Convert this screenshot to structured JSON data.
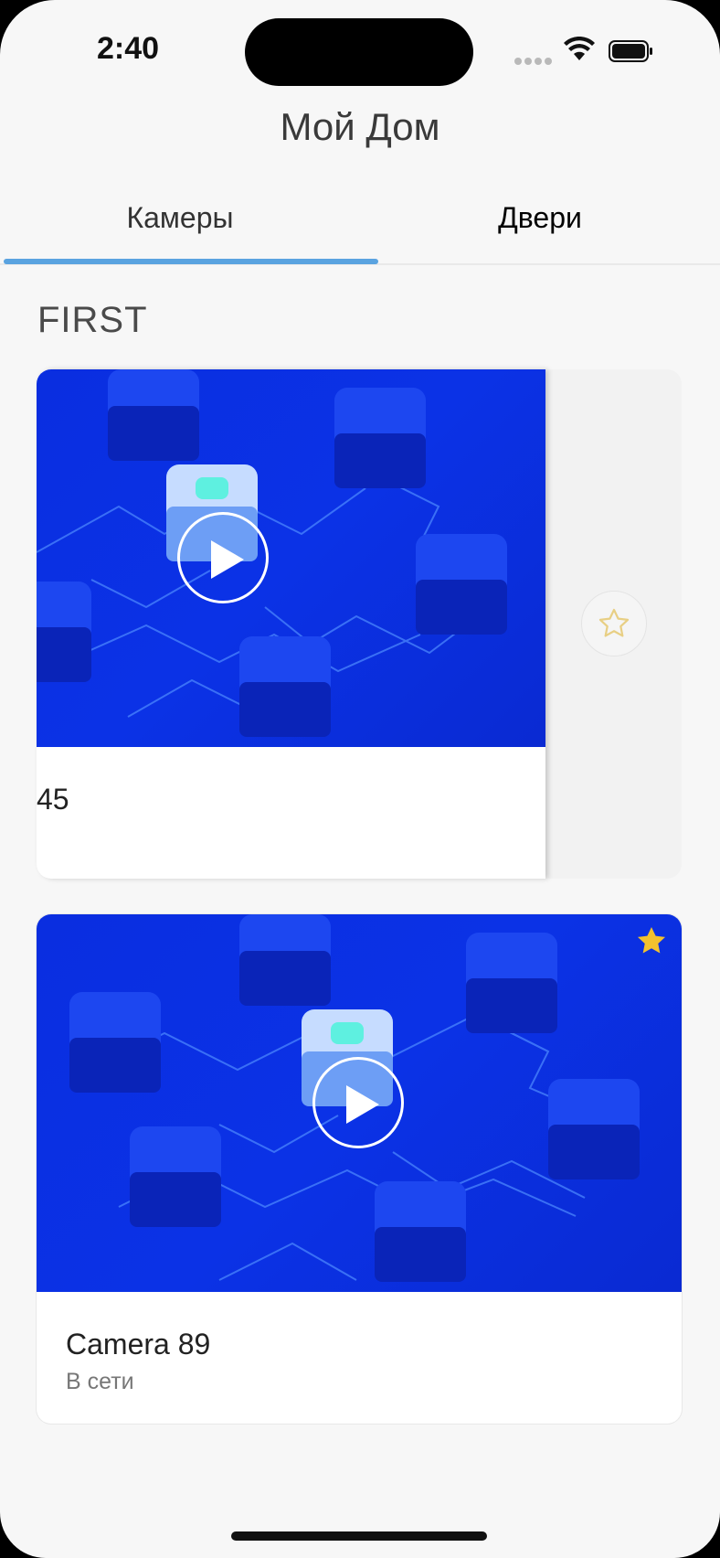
{
  "status_bar": {
    "time": "2:40"
  },
  "header": {
    "title": "Мой Дом"
  },
  "tabs": [
    {
      "label": "Камеры",
      "selected": true
    },
    {
      "label": "Двери",
      "selected": false
    }
  ],
  "colors": {
    "accent": "#5aa3e0",
    "thumbnail_blue": "#0b32e6",
    "favorite_gold": "#f2c12e"
  },
  "section": {
    "title": "FIRST",
    "cameras": [
      {
        "name": "45",
        "status": "",
        "favorite": false,
        "swipe_action_icon": "star-outline-icon"
      },
      {
        "name": "Camera 89",
        "status": "В сети",
        "favorite": true
      }
    ]
  }
}
